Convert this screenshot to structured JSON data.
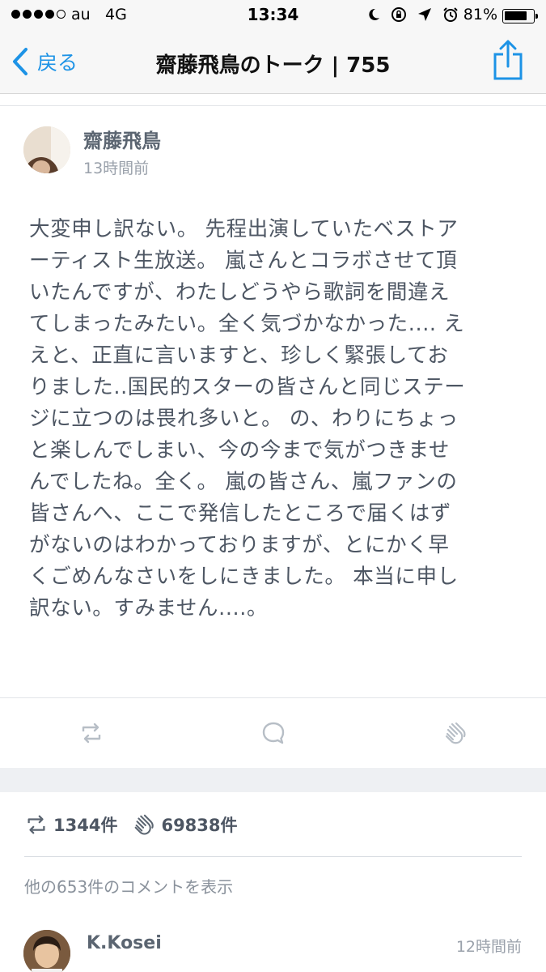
{
  "status_bar": {
    "carrier": "au",
    "network": "4G",
    "time": "13:34",
    "battery_percent_label": "81%",
    "battery_level": 0.81,
    "icons": [
      "moon-icon",
      "rotation-lock-icon",
      "location-arrow-icon",
      "alarm-icon"
    ]
  },
  "nav": {
    "back_label": "戻る",
    "title": "齋藤飛鳥のトーク | 755",
    "back_icon": "chevron-left-icon",
    "share_icon": "share-icon",
    "accent_color": "#1d93e6"
  },
  "post": {
    "author": "齋藤飛鳥",
    "time": "13時間前",
    "lines": [
      "大変申し訳ない。 先程出演していたベストア",
      "ーティスト生放送。 嵐さんとコラボさせて頂",
      "いたんですが、わたしどうやら歌詞を間違え",
      "てしまったみたい。全く気づかなかった.... え",
      "えと、正直に言いますと、珍しく緊張してお",
      "りました..国民的スターの皆さんと同じステー",
      "ジに立つのは畏れ多いと。 の、わりにちょっ",
      "と楽しんでしまい、今の今まで気がつきませ",
      "んでしたね。全く。 嵐の皆さん、嵐ファンの",
      "皆さんへ、ここで発信したところで届くはず",
      "がないのはわかっておりますが、とにかく早",
      "くごめんなさいをしにきました。 本当に申し",
      "訳ない。すみません....。"
    ]
  },
  "actions": {
    "repost_icon": "repost-icon",
    "comment_icon": "comment-bubble-icon",
    "clap_icon": "clap-icon"
  },
  "stats": {
    "reposts": "1344件",
    "claps": "69838件"
  },
  "more_comments": "他の653件のコメントを表示",
  "comment": {
    "author": "K.Kosei",
    "time": "12時間前"
  }
}
